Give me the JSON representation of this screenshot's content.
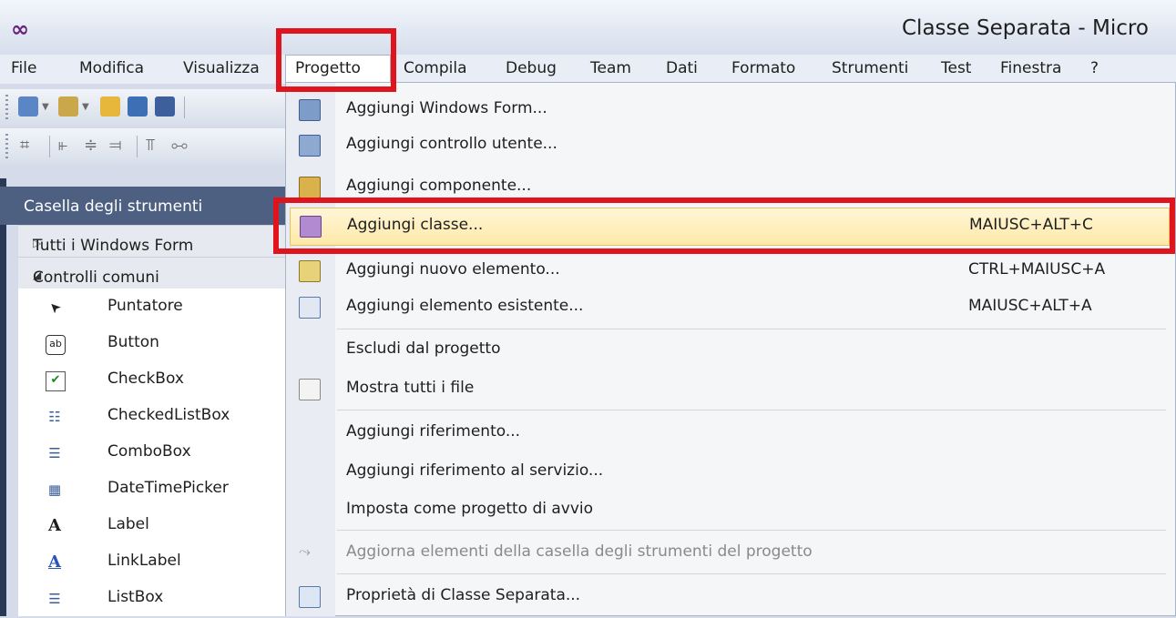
{
  "window": {
    "title": "Classe Separata - Micro"
  },
  "menubar": {
    "items": [
      "File",
      "Modifica",
      "Visualizza",
      "Progetto",
      "Compila",
      "Debug",
      "Team",
      "Dati",
      "Formato",
      "Strumenti",
      "Test",
      "Finestra",
      "?"
    ]
  },
  "toolbox": {
    "title": "Casella degli strumenti",
    "groups": [
      {
        "label": "Tutti i Windows Form",
        "expanded": false,
        "glyph": "▷"
      },
      {
        "label": "Controlli comuni",
        "expanded": true,
        "glyph": "◢"
      }
    ],
    "tools": [
      {
        "label": "Puntatore",
        "icon": "pointer-icon",
        "glyph": "➤"
      },
      {
        "label": "Button",
        "icon": "button-icon",
        "glyph": "ab"
      },
      {
        "label": "CheckBox",
        "icon": "checkbox-icon",
        "glyph": "✔"
      },
      {
        "label": "CheckedListBox",
        "icon": "checkedlistbox-icon",
        "glyph": "☷"
      },
      {
        "label": "ComboBox",
        "icon": "combobox-icon",
        "glyph": "☰"
      },
      {
        "label": "DateTimePicker",
        "icon": "datetimepicker-icon",
        "glyph": "▦"
      },
      {
        "label": "Label",
        "icon": "label-icon",
        "glyph": "A"
      },
      {
        "label": "LinkLabel",
        "icon": "linklabel-icon",
        "glyph": "A"
      },
      {
        "label": "ListBox",
        "icon": "listbox-icon",
        "glyph": "☰"
      }
    ]
  },
  "dropdown": {
    "items": [
      {
        "label": "Aggiungi Windows Form...",
        "shortcut": "",
        "icon": "windows-form-icon"
      },
      {
        "label": "Aggiungi controllo utente...",
        "shortcut": "",
        "icon": "user-control-icon"
      },
      {
        "label": "Aggiungi componente...",
        "shortcut": "",
        "icon": "component-icon"
      },
      {
        "label": "Aggiungi classe...",
        "shortcut": "MAIUSC+ALT+C",
        "icon": "add-class-icon"
      },
      {
        "label": "Aggiungi nuovo elemento...",
        "shortcut": "CTRL+MAIUSC+A",
        "icon": "new-item-icon"
      },
      {
        "label": "Aggiungi elemento esistente...",
        "shortcut": "MAIUSC+ALT+A",
        "icon": "existing-item-icon"
      },
      {
        "label": "Escludi dal progetto",
        "shortcut": "",
        "icon": ""
      },
      {
        "label": "Mostra tutti i file",
        "shortcut": "",
        "icon": "show-all-files-icon"
      },
      {
        "label": "Aggiungi riferimento...",
        "shortcut": "",
        "icon": ""
      },
      {
        "label": "Aggiungi riferimento al servizio...",
        "shortcut": "",
        "icon": ""
      },
      {
        "label": "Imposta come progetto di avvio",
        "shortcut": "",
        "icon": ""
      },
      {
        "label": "Aggiorna elementi della casella degli strumenti del progetto",
        "shortcut": "",
        "icon": "refresh-toolbox-icon"
      },
      {
        "label": "Proprietà di Classe Separata...",
        "shortcut": "",
        "icon": "properties-icon"
      }
    ]
  },
  "colors": {
    "highlight": "#ffe9a8",
    "annotation": "#e0141c",
    "toolbox_header": "#4d6082"
  }
}
